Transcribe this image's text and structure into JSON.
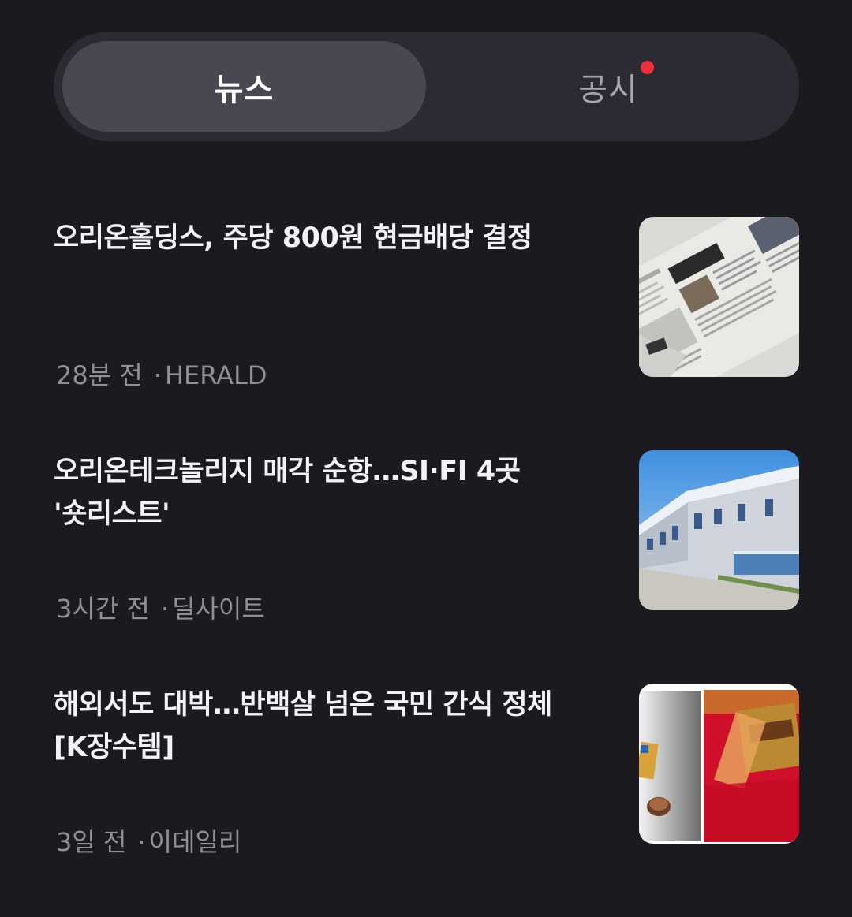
{
  "tabs": {
    "news": "뉴스",
    "disclosure": "공시"
  },
  "news": [
    {
      "title": "오리온홀딩스, 주당 800원 현금배당 결정",
      "time": "28분 전",
      "source": "HERALD",
      "thumb_icon": "newspaper-image"
    },
    {
      "title": "오리온테크놀리지 매각 순항…SI·FI 4곳 '숏리스트'",
      "time": "3시간 전",
      "source": "딜사이트",
      "thumb_icon": "factory-building-image"
    },
    {
      "title": "해외서도 대박…반백살 넘은 국민 간식 정체[K장수템]",
      "time": "3일 전",
      "source": "이데일리",
      "thumb_icon": "snack-package-image"
    }
  ],
  "colors": {
    "background": "#1a1a1f",
    "notification_dot": "#ef2f3c"
  }
}
